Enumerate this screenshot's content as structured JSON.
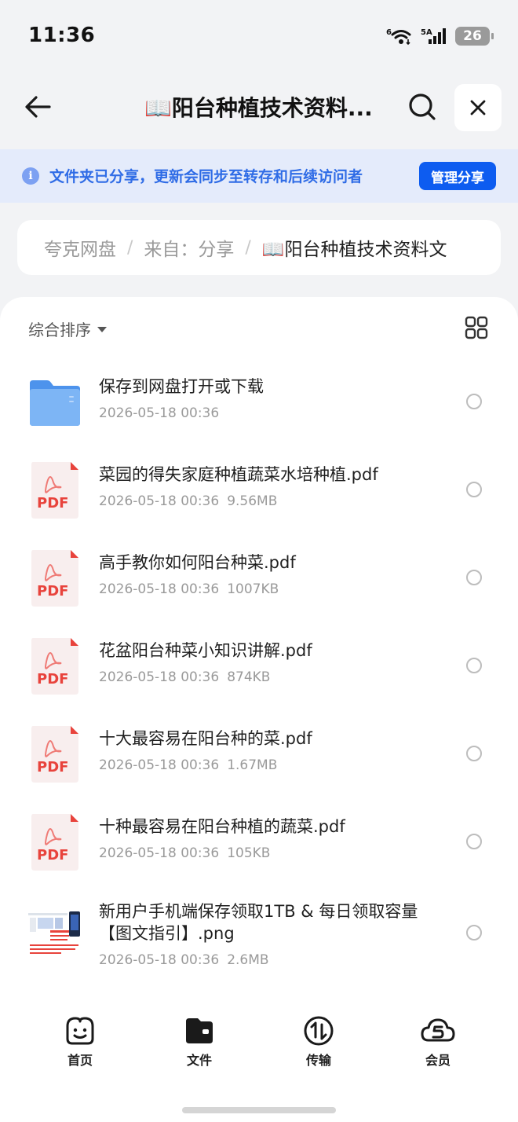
{
  "status_bar": {
    "time": "11:36",
    "wifi_label": "6",
    "signal_label": "5A",
    "battery": "26"
  },
  "header": {
    "title": "📖阳台种植技术资料..."
  },
  "share_banner": {
    "text": "文件夹已分享，更新会同步至转存和后续访问者",
    "button": "管理分享"
  },
  "breadcrumb": {
    "items": [
      "夸克网盘",
      "来自：分享",
      "📖阳台种植技术资料文"
    ]
  },
  "list": {
    "sort_label": "综合排序",
    "files": [
      {
        "name": "保存到网盘打开或下载",
        "date": "2026-05-18 00:36",
        "size": "",
        "icon": "folder-icon"
      },
      {
        "name": "菜园的得失家庭种植蔬菜水培种植.pdf",
        "date": "2026-05-18 00:36",
        "size": "9.56MB",
        "icon": "pdf-icon"
      },
      {
        "name": "高手教你如何阳台种菜.pdf",
        "date": "2026-05-18 00:36",
        "size": "1007KB",
        "icon": "pdf-icon"
      },
      {
        "name": "花盆阳台种菜小知识讲解.pdf",
        "date": "2026-05-18 00:36",
        "size": "874KB",
        "icon": "pdf-icon"
      },
      {
        "name": "十大最容易在阳台种的菜.pdf",
        "date": "2026-05-18 00:36",
        "size": "1.67MB",
        "icon": "pdf-icon"
      },
      {
        "name": "十种最容易在阳台种植的蔬菜.pdf",
        "date": "2026-05-18 00:36",
        "size": "105KB",
        "icon": "pdf-icon"
      },
      {
        "name": "新用户手机端保存领取1TB & 每日领取容量【图文指引】.png",
        "date": "2026-05-18 00:36",
        "size": "2.6MB",
        "icon": "image-thumbnail"
      }
    ],
    "pdf_badge": "PDF"
  },
  "bottom_nav": {
    "items": [
      {
        "label": "首页",
        "icon": "smile-face-icon"
      },
      {
        "label": "文件",
        "icon": "wallet-folder-icon"
      },
      {
        "label": "传输",
        "icon": "transfer-icon"
      },
      {
        "label": "会员",
        "icon": "cloud-s-icon"
      }
    ]
  },
  "colors": {
    "accent": "#0d5cf0",
    "banner_bg": "#e4ebfb",
    "banner_text": "#2f6ce6",
    "pdf_red": "#e8433c",
    "folder_blue": "#5a9ff0"
  }
}
